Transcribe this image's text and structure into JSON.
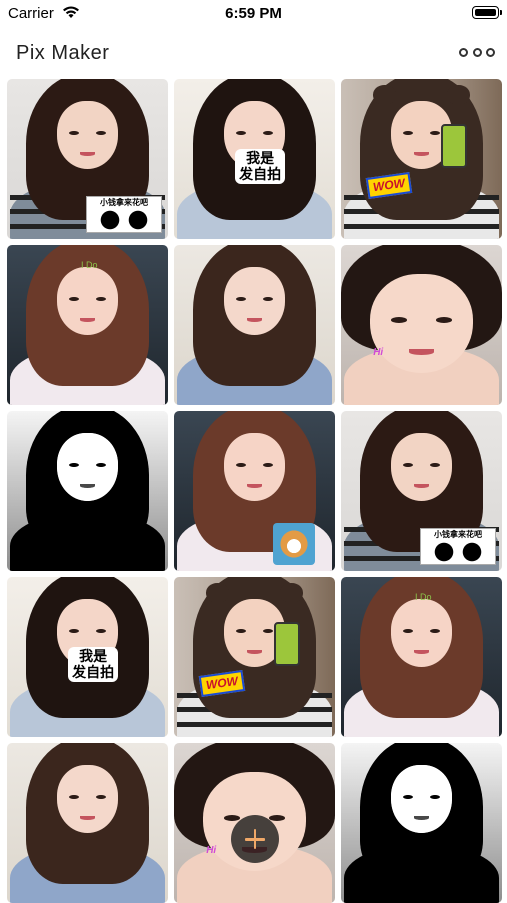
{
  "status_bar": {
    "carrier": "Carrier",
    "time": "6:59 PM"
  },
  "nav": {
    "title": "Pix Maker",
    "more_icon": "more-circles-icon"
  },
  "colors": {
    "background": "#ffffff",
    "title": "#222222",
    "fab": "#1a1a1a",
    "fab_plus": "#f0a868"
  },
  "tiles": [
    {
      "variant": "stripes-panda",
      "sticker_text": "小钱拿来花吧"
    },
    {
      "variant": "woyao",
      "sticker_text": "我是\n发自拍"
    },
    {
      "variant": "bear-wow",
      "sticker_text": "WOW"
    },
    {
      "variant": "car-ido",
      "sticker_text": "I Do"
    },
    {
      "variant": "sweater",
      "sticker_text": ""
    },
    {
      "variant": "closeup-hi",
      "sticker_text": "Hi"
    },
    {
      "variant": "bw",
      "sticker_text": ""
    },
    {
      "variant": "car-dog",
      "sticker_text": ""
    },
    {
      "variant": "stripes-panda",
      "sticker_text": "小钱拿来花吧"
    },
    {
      "variant": "woyao",
      "sticker_text": "我是\n发自拍"
    },
    {
      "variant": "bear-wow",
      "sticker_text": "WOW"
    },
    {
      "variant": "car-ido",
      "sticker_text": "I Do"
    },
    {
      "variant": "sweater",
      "sticker_text": ""
    },
    {
      "variant": "closeup-hi",
      "sticker_text": "Hi"
    },
    {
      "variant": "bw",
      "sticker_text": ""
    }
  ],
  "add_button": {
    "icon": "plus-icon"
  }
}
